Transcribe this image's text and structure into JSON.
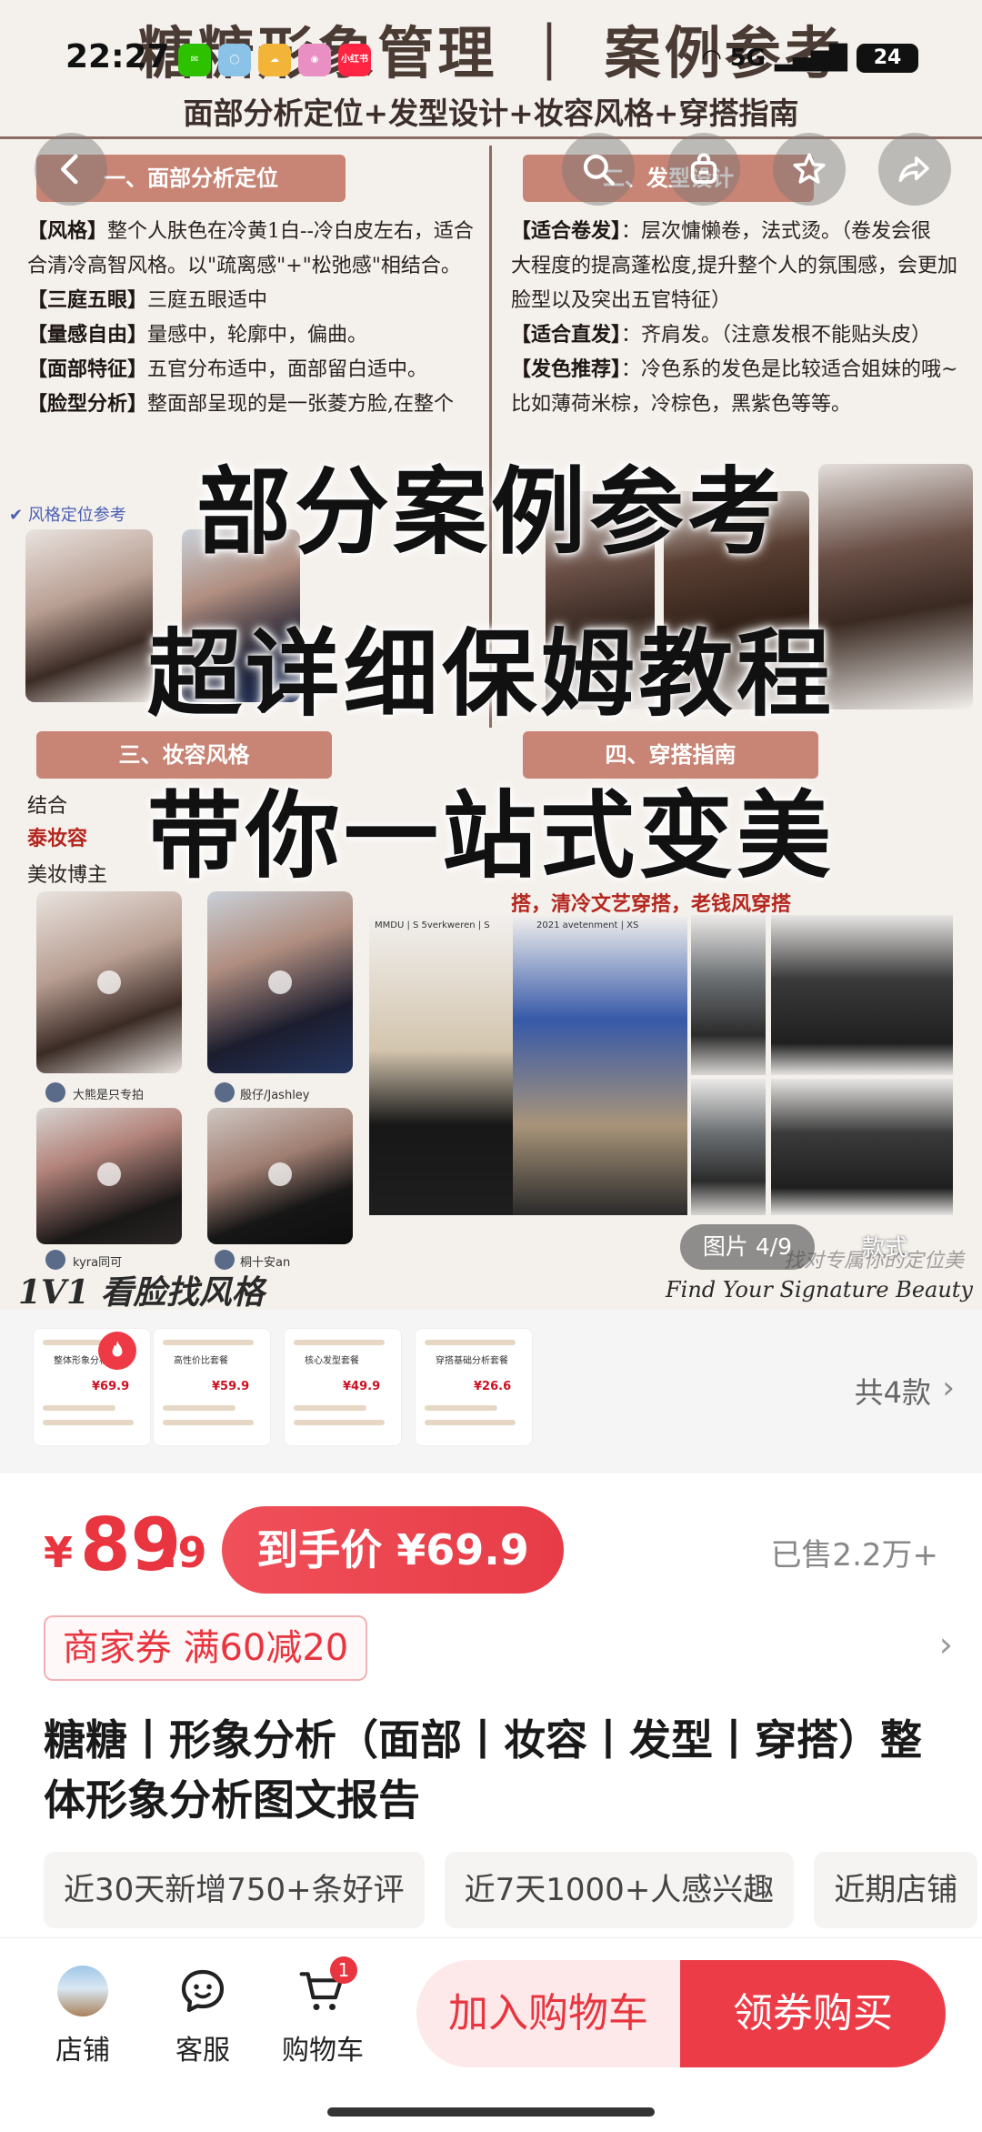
{
  "status_bar": {
    "time": "22:27",
    "apps": [
      {
        "name": "wechat-icon",
        "label": "",
        "color": "#2dc100"
      },
      {
        "name": "app-circle-icon",
        "label": "",
        "color": "#8bc3e8"
      },
      {
        "name": "weather-icon",
        "label": "",
        "color": "#f3b43a"
      },
      {
        "name": "camera-app-icon",
        "label": "",
        "color": "#e98fc3"
      },
      {
        "name": "xiaohongshu-icon",
        "label": "小红书",
        "color": "#ff2442"
      }
    ],
    "network": "5G",
    "battery": "24"
  },
  "hero": {
    "doc_title": "糖糖形象管理 ｜ 案例参考",
    "doc_subtitle": "面部分析定位+发型设计+妆容风格+穿搭指南",
    "sections": {
      "face": "一、面部分析定位",
      "hair": "二、发型设计",
      "makeup": "三、妆容风格",
      "outfit": "四、穿搭指南"
    },
    "face_lines": [
      {
        "key": "【风格】",
        "text": "整个人肤色在冷黄1白--冷白皮左右，适合"
      },
      {
        "key": "",
        "text": "合清冷高智风格。以\"疏离感\"+\"松弛感\"相结合。"
      },
      {
        "key": "【三庭五眼】",
        "text": "三庭五眼适中"
      },
      {
        "key": "【量感自由】",
        "text": "量感中，轮廓中，偏曲。"
      },
      {
        "key": "【面部特征】",
        "text": "五官分布适中，面部留白适中。"
      },
      {
        "key": "【脸型分析】",
        "text": "整面部呈现的是一张菱方脸,在整个"
      }
    ],
    "hair_lines": [
      {
        "key": "【适合卷发】",
        "text": "：层次慵懒卷，法式烫。（卷发会很"
      },
      {
        "key": "",
        "text": "大程度的提高蓬松度,提升整个人的氛围感，会更加"
      },
      {
        "key": "",
        "text": "脸型以及突出五官特征）"
      },
      {
        "key": "【适合直发】",
        "text": "：齐肩发。（注意发根不能贴头皮）"
      },
      {
        "key": "【发色推荐】",
        "text": "：冷色系的发色是比较适合姐妹的哦~"
      },
      {
        "key": "",
        "text": "比如薄荷米棕，冷棕色，黑紫色等等。"
      }
    ],
    "face_check_label": "风格定位参考",
    "makeup_intro": "结合",
    "makeup_red": "泰妆容",
    "makeup_blogger": "美妆博主",
    "outfit_line": "搭，清冷文艺穿搭，老钱风穿搭",
    "overlay_lines": [
      "部分案例参考",
      "超详细保姆教程",
      "带你一站式变美"
    ],
    "photo_handles": [
      "大熊是只专拍",
      "殷仔/Jashley",
      "kyra同可",
      "桐十安an"
    ],
    "outfit_tags": [
      "MMDU | S 5verkweren | S",
      "2021 avetenment | XS"
    ],
    "footer_cn": "1V1 看脸找风格",
    "footer_en": "Find Your Signature Beauty",
    "footer_en_cn": "找对专属你的定位美",
    "counter": "图片 4/9",
    "style_label": "款式"
  },
  "nav": {
    "back": "back-icon",
    "search": "search-icon",
    "share_store": "store-share-icon",
    "favorite": "star-icon",
    "share": "share-icon"
  },
  "variants": {
    "items": [
      {
        "title": "整体形象分析",
        "price": "¥69.9",
        "hot": true
      },
      {
        "title": "高性价比套餐",
        "price": "¥59.9",
        "hot": false
      },
      {
        "title": "核心发型套餐",
        "price": "¥49.9",
        "hot": false
      },
      {
        "title": "穿搭基础分析套餐",
        "price": "¥26.6",
        "hot": false
      }
    ],
    "count_label": "共4款"
  },
  "product": {
    "price_currency": "¥",
    "price_integer": "89",
    "price_decimal": ".9",
    "final_price": "到手价 ¥69.9",
    "sold": "已售2.2万+",
    "coupon": "商家券 满60减20",
    "title": "糖糖丨形象分析（面部丨妆容丨发型丨穿搭）整体形象分析图文报告",
    "chips": [
      "近30天新增750+条好评",
      "近7天1000+人感兴趣",
      "近期店铺"
    ]
  },
  "bottom_bar": {
    "shop": "店铺",
    "service": "客服",
    "cart": "购物车",
    "cart_badge": "1",
    "add_to_cart": "加入购物车",
    "buy_now": "领券购买"
  },
  "colors": {
    "accent": "#e8353f",
    "section_banner": "#c88474"
  }
}
